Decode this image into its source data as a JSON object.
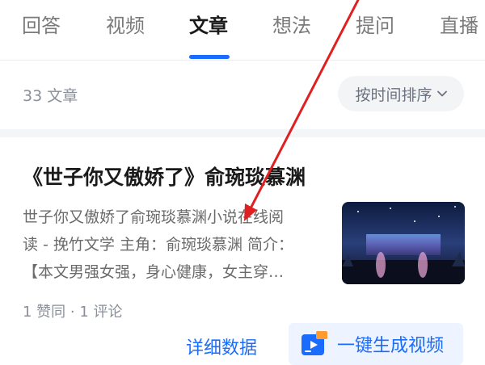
{
  "tabs": [
    {
      "label": "回答",
      "active": false
    },
    {
      "label": "视频",
      "active": false
    },
    {
      "label": "文章",
      "active": true
    },
    {
      "label": "想法",
      "active": false
    },
    {
      "label": "提问",
      "active": false
    },
    {
      "label": "直播",
      "active": false
    }
  ],
  "list_header": {
    "count_text": "33 文章",
    "sort_label": "按时间排序"
  },
  "article": {
    "title": "《世子你又傲娇了》俞琬琰慕渊",
    "excerpt_lines": [
      "世子你又傲娇了俞琬琰慕渊小说在线阅",
      "读 - 挽竹文学 主角：俞琬琰慕渊 简介：",
      "【本文男强女强，身心健康，女主穿…"
    ],
    "stats": "1 赞同 · 1 评论",
    "detail_label": "详细数据",
    "video_button_label": "一键生成视频"
  },
  "colors": {
    "accent": "#1a6cff",
    "annotation_arrow": "#e02020"
  },
  "icons": {
    "sort": "chevron-down-icon",
    "video": "video-generate-icon"
  }
}
